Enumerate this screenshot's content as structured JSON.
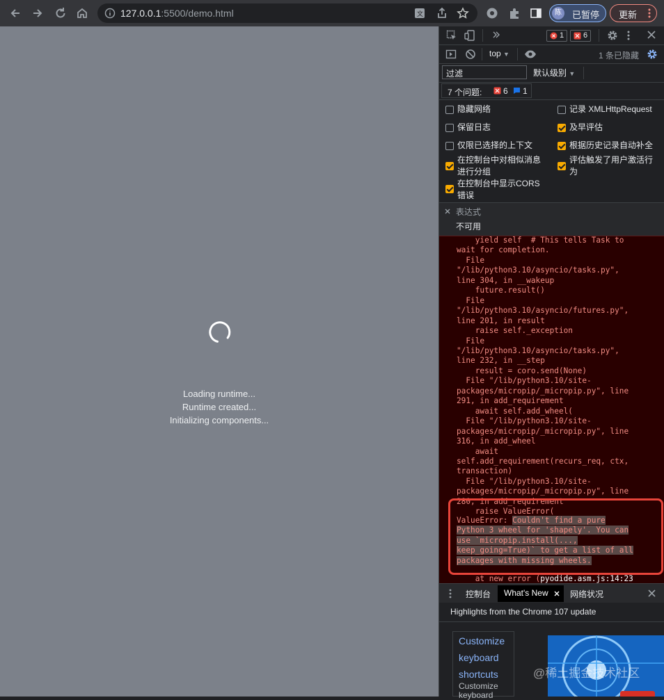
{
  "browser": {
    "url_host": "127.0.0.1",
    "url_rest": ":5500/demo.html",
    "profile_initial": "陈",
    "profile_status": "已暂停",
    "update_label": "更新"
  },
  "page": {
    "status_lines": [
      "Loading runtime...",
      "Runtime created...",
      "Initializing components..."
    ]
  },
  "devtools": {
    "error_count": "1",
    "warning_count": "6",
    "context": "top",
    "hidden_count": "1 条已隐藏",
    "filter_value": "过滤",
    "log_level": "默认级别",
    "issues_label": "7 个问题:",
    "issues_errors": "6",
    "issues_info": "1",
    "settings": {
      "left": [
        {
          "label": "隐藏网络",
          "checked": false
        },
        {
          "label": "保留日志",
          "checked": false
        },
        {
          "label": "仅限已选择的上下文",
          "checked": false
        },
        {
          "label": "在控制台中对相似消息进行分组",
          "checked": true
        },
        {
          "label": "在控制台中显示CORS错误",
          "checked": true
        }
      ],
      "right": [
        {
          "label": "记录 XMLHttpRequest",
          "checked": false
        },
        {
          "label": "及早评估",
          "checked": true
        },
        {
          "label": "根据历史记录自动补全",
          "checked": true
        },
        {
          "label": "评估触发了用户激活行为",
          "checked": true
        }
      ]
    },
    "expression_label": "表达式",
    "expression_value": "不可用",
    "console_text": "    yield self  # This tells Task to\nwait for completion.\n  File\n\"/lib/python3.10/asyncio/tasks.py\",\nline 304, in __wakeup\n    future.result()\n  File\n\"/lib/python3.10/asyncio/futures.py\",\nline 201, in result\n    raise self._exception\n  File\n\"/lib/python3.10/asyncio/tasks.py\",\nline 232, in __step\n    result = coro.send(None)\n  File \"/lib/python3.10/site-\npackages/micropip/_micropip.py\", line\n291, in add_requirement\n    await self.add_wheel(\n  File \"/lib/python3.10/site-\npackages/micropip/_micropip.py\", line\n316, in add_wheel\n    await\nself.add_requirement(recurs_req, ctx,\ntransaction)\n  File \"/lib/python3.10/site-\npackages/micropip/_micropip.py\", line\n280, in add_requirement\n    raise ValueError(",
    "error_prefix": "ValueError: ",
    "error_message": "Couldn't find a pure\nPython 3 wheel for 'shapely'. You can\nuse `micropip.install(...,\nkeep_going=True)` to get a list of all\npackages with missing wheels.",
    "stack_prefix": "    at new error (",
    "stack_file": "pyodide.asm.js:14:23",
    "drawer_tabs": [
      "控制台",
      "What's New",
      "网络状况"
    ],
    "whatsnew_title": "Highlights from the Chrome 107 update",
    "links": [
      "Customize",
      "keyboard",
      "shortcuts",
      "Customize",
      "keyboard"
    ],
    "watermark": "@稀土掘金技术社区"
  }
}
